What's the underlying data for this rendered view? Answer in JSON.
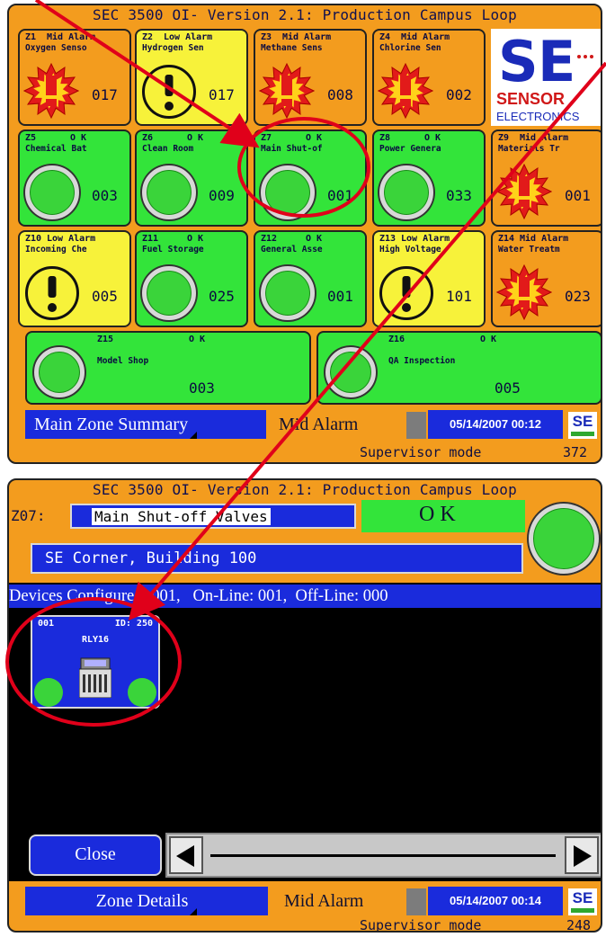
{
  "top": {
    "title": "SEC 3500 OI- Version 2.1: Production Campus Loop",
    "tiles": [
      {
        "zone": "Z1",
        "status": "Mid Alarm",
        "name": "Oxygen Senso",
        "count": "017",
        "kind": "alarm"
      },
      {
        "zone": "Z2",
        "status": "Low Alarm",
        "name": "Hydrogen Sen",
        "count": "017",
        "kind": "low"
      },
      {
        "zone": "Z3",
        "status": "Mid Alarm",
        "name": "Methane Sens",
        "count": "008",
        "kind": "alarm"
      },
      {
        "zone": "Z4",
        "status": "Mid Alarm",
        "name": "Chlorine Sen",
        "count": "002",
        "kind": "alarm"
      },
      {
        "zone": "Z5",
        "status": "O K",
        "name": "Chemical Bat",
        "count": "003",
        "kind": "ok"
      },
      {
        "zone": "Z6",
        "status": "O K",
        "name": "Clean Room",
        "count": "009",
        "kind": "ok"
      },
      {
        "zone": "Z7",
        "status": "O K",
        "name": "Main Shut-of",
        "count": "001",
        "kind": "ok"
      },
      {
        "zone": "Z8",
        "status": "O K",
        "name": "Power Genera",
        "count": "033",
        "kind": "ok"
      },
      {
        "zone": "Z9",
        "status": "Mid Alarm",
        "name": "Materials Tr",
        "count": "001",
        "kind": "alarm"
      },
      {
        "zone": "Z10",
        "status": "Low Alarm",
        "name": "Incoming Che",
        "count": "005",
        "kind": "low"
      },
      {
        "zone": "Z11",
        "status": "O K",
        "name": "Fuel Storage",
        "count": "025",
        "kind": "ok"
      },
      {
        "zone": "Z12",
        "status": "O K",
        "name": "General Asse",
        "count": "001",
        "kind": "ok"
      },
      {
        "zone": "Z13",
        "status": "Low Alarm",
        "name": "High Voltage",
        "count": "101",
        "kind": "low"
      },
      {
        "zone": "Z14",
        "status": "Mid Alarm",
        "name": "Water Treatm",
        "count": "023",
        "kind": "alarm"
      },
      {
        "zone": "Z15",
        "status": "O K",
        "name": "Model Shop",
        "count": "003",
        "kind": "ok"
      },
      {
        "zone": "Z16",
        "status": "O K",
        "name": "QA Inspection",
        "count": "005",
        "kind": "ok"
      }
    ],
    "logo": {
      "mark": "SE",
      "line1": "SENSOR",
      "line2": "ELECTRONICS"
    },
    "menu_label": "Main Zone Summary",
    "alarm_label": "Mid Alarm",
    "datetime": "05/14/2007 00:12",
    "mode": "Supervisor mode",
    "mode_number": "372"
  },
  "bottom": {
    "title": "SEC 3500 OI- Version 2.1: Production Campus Loop",
    "zone_id": "Z07:",
    "zone_name": "Main Shut-off Valves",
    "zone_status": "O K",
    "location": "SE Corner, Building 100",
    "devices_line": "Devices Configured: 001,   On-Line: 001,  Off-Line: 000",
    "device": {
      "number": "001",
      "id": "ID: 250",
      "model": "RLY16"
    },
    "close_label": "Close",
    "menu_label": "Zone Details",
    "alarm_label": "Mid Alarm",
    "datetime": "05/14/2007 00:14",
    "mode": "Supervisor mode",
    "mode_number": "248",
    "logo_mark": "SE"
  },
  "colors": {
    "alarm": "#f39c1e",
    "low": "#f7f23a",
    "ok": "#33e43a",
    "accent": "#1a2bdc",
    "annotation": "#e0001a"
  }
}
